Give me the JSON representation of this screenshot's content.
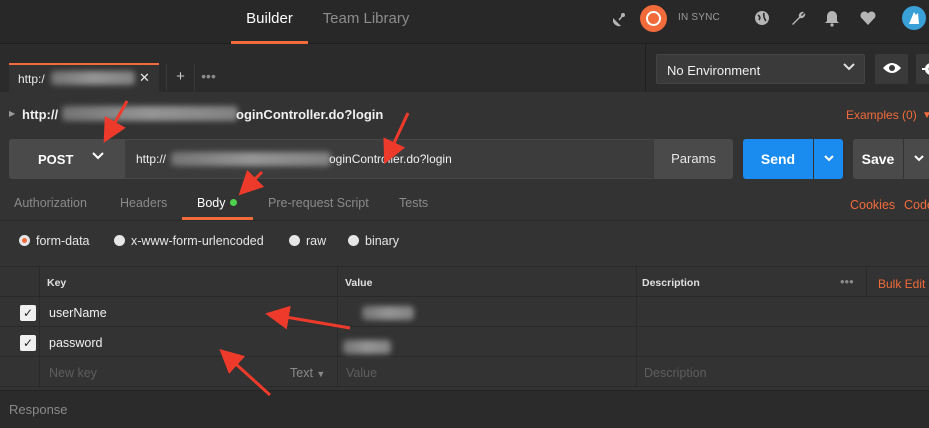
{
  "top": {
    "tabs": [
      {
        "label": "Builder",
        "active": true
      },
      {
        "label": "Team Library",
        "active": false
      }
    ],
    "sync_status": "IN SYNC",
    "icons": [
      "satellite-icon",
      "sync-icon",
      "globe-icon",
      "wrench-icon",
      "bell-icon",
      "heart-icon",
      "avatar-icon"
    ]
  },
  "request_tab": {
    "label": "http:/",
    "close": "✕",
    "add": "+",
    "more": "•••"
  },
  "environment": {
    "selected": "No Environment"
  },
  "request": {
    "title_prefix": "http://",
    "title_suffix": "oginController.do?login",
    "examples": "Examples (0)",
    "method": "POST",
    "url_prefix": "http://",
    "url_suffix": "oginController.do?login",
    "params_label": "Params",
    "send_label": "Send",
    "save_label": "Save"
  },
  "subtabs": {
    "items": [
      "Authorization",
      "Headers",
      "Body",
      "Pre-request Script",
      "Tests"
    ],
    "active": "Body",
    "cookies": "Cookies",
    "code": "Code"
  },
  "body_types": [
    {
      "label": "form-data",
      "selected": true
    },
    {
      "label": "x-www-form-urlencoded",
      "selected": false
    },
    {
      "label": "raw",
      "selected": false
    },
    {
      "label": "binary",
      "selected": false
    }
  ],
  "table": {
    "headers": {
      "key": "Key",
      "value": "Value",
      "description": "Description"
    },
    "bulk_edit": "Bulk Edit",
    "rows": [
      {
        "key": "userName",
        "checked": true
      },
      {
        "key": "password",
        "checked": true
      }
    ],
    "new_row": {
      "key_placeholder": "New key",
      "type": "Text",
      "value_placeholder": "Value",
      "description_placeholder": "Description"
    }
  },
  "response_label": "Response",
  "colors": {
    "accent": "#f26b3a",
    "send": "#1a8cf0",
    "background": "#333333"
  }
}
